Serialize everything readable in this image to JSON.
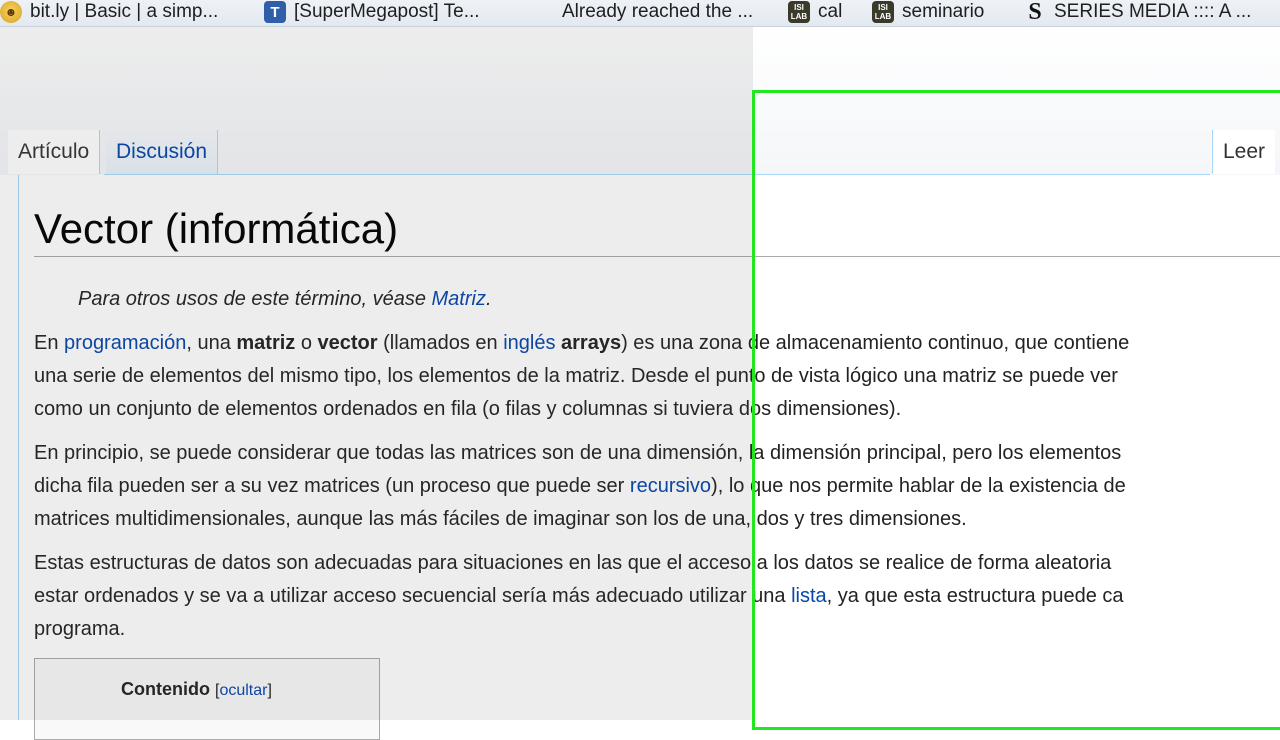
{
  "bookmarks": [
    {
      "label": "bit.ly | Basic | a simp...",
      "icon": "smiley-icon"
    },
    {
      "label": "[SuperMegapost] Te...",
      "icon": "taringa-icon"
    },
    {
      "label": "Already reached the ...",
      "icon": "none"
    },
    {
      "label": "cal",
      "icon": "isi-lab-icon",
      "icon_text": "ISI\nLAB"
    },
    {
      "label": "seminario",
      "icon": "isi-lab-icon",
      "icon_text": "ISI\nLAB"
    },
    {
      "label": "SERIES MEDIA :::: A ...",
      "icon": "s-logo-icon",
      "icon_text": "S"
    }
  ],
  "tabs": {
    "article": "Artículo",
    "discussion": "Discusión",
    "read": "Leer"
  },
  "article": {
    "title": "Vector (informática)",
    "hatnote": {
      "prefix": "Para otros usos de este término, véase ",
      "link": "Matriz",
      "suffix": "."
    },
    "p1": {
      "t1": "En ",
      "l1": "programación",
      "t2": ", una ",
      "b1": "matriz",
      "t3": " o ",
      "b2": "vector",
      "t4": " (llamados en ",
      "l2": "inglés",
      "t5": " ",
      "b3": "arrays",
      "t6": ") es una zona de almacenamiento continuo, que contiene",
      "line2": "una serie de elementos del mismo tipo, los elementos de la matriz. Desde el punto de vista lógico una matriz se puede ver",
      "line3": "como un conjunto de elementos ordenados en fila (o filas y columnas si tuviera dos dimensiones)."
    },
    "p2": {
      "line1": "En principio, se puede considerar que todas las matrices son de una dimensión, la dimensión principal, pero los elementos",
      "t1": "dicha fila pueden ser a su vez matrices (un proceso que puede ser ",
      "l1": "recursivo",
      "t2": "), lo que nos permite hablar de la existencia de",
      "line3": "matrices multidimensionales, aunque las más fáciles de imaginar son los de una, dos y tres dimensiones."
    },
    "p3": {
      "line1": "Estas estructuras de datos son adecuadas para situaciones en las que el acceso a los datos se realice de forma aleatoria",
      "t1": "estar ordenados y se va a utilizar acceso secuencial sería más adecuado utilizar una ",
      "l1": "lista",
      "t2": ", ya que esta estructura puede ca",
      "line3": "programa."
    },
    "toc": {
      "title": "Contenido",
      "open": "[",
      "toggle": "ocultar",
      "close": "]"
    }
  },
  "colors": {
    "link": "#0645ad",
    "selection_border": "#22e61e",
    "tab_border": "#a7d7f9"
  }
}
